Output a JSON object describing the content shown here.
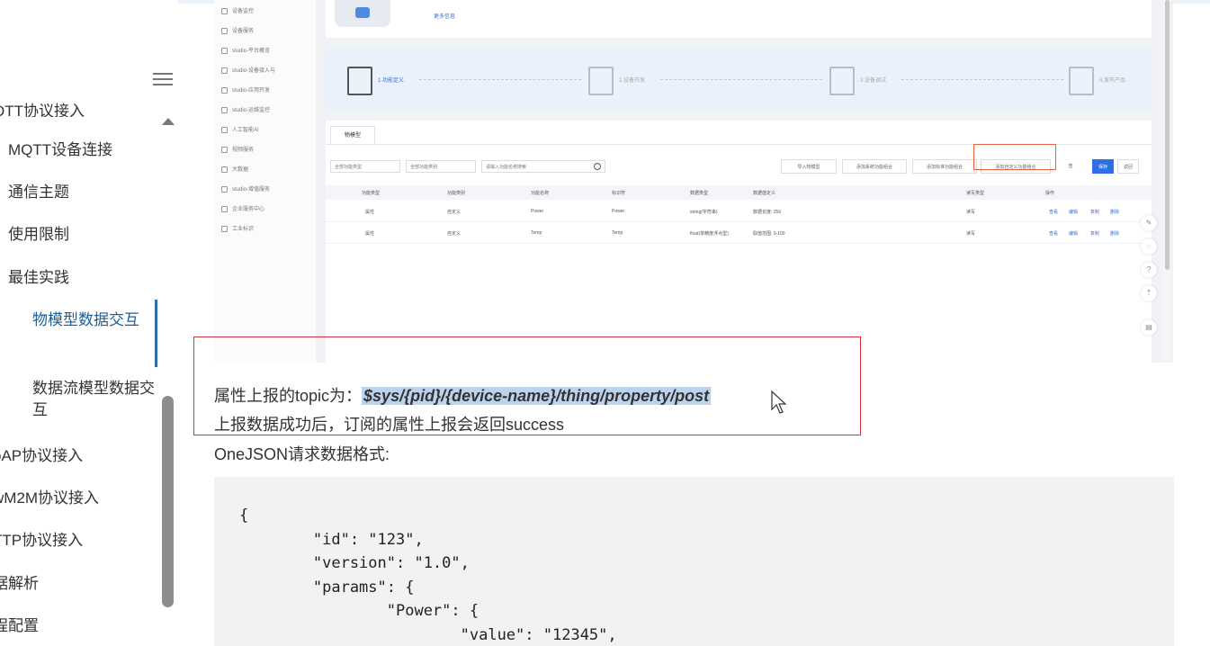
{
  "nav": {
    "items": [
      {
        "label": "QTT协议接入",
        "kind": "cut"
      },
      {
        "label": "MQTT设备连接",
        "kind": "item"
      },
      {
        "label": "通信主题",
        "kind": "item"
      },
      {
        "label": "使用限制",
        "kind": "item"
      },
      {
        "label": "最佳实践",
        "kind": "item"
      },
      {
        "label": "物模型数据交互",
        "kind": "active"
      },
      {
        "label": "数据流模型数据交互",
        "kind": "sub"
      },
      {
        "label": "oAP协议接入",
        "kind": "cut"
      },
      {
        "label": "wM2M协议接入",
        "kind": "cut"
      },
      {
        "label": "TTP协议接入",
        "kind": "cut"
      },
      {
        "label": "据解析",
        "kind": "cut"
      },
      {
        "label": "程配置",
        "kind": "cut"
      }
    ]
  },
  "embed": {
    "sidebar": [
      "设备监控",
      "设备服务",
      "studio-平台概览",
      "studio-设备接入与",
      "studio-应用开发",
      "studio-运维监控",
      "人工智能AI",
      "视频服务",
      "大数据",
      "studio-增值服务",
      "企业服务中心",
      "工业标识"
    ],
    "more_label": "更多信息",
    "steps": [
      "1.功能定义",
      "2.设备开发",
      "3.设备调试",
      "4.发布产品"
    ],
    "tab": "物模型",
    "filters": {
      "type": "全部功能类型",
      "category": "全部功能类别",
      "search_placeholder": "请输入功能名称搜索"
    },
    "buttons": {
      "import": "导入物模型",
      "add_system": "添加系统功能组合",
      "add_standard": "添加标准功能组合",
      "add_custom": "添加自定义功能组合",
      "more": "查",
      "save": "保存",
      "back": "返回"
    },
    "columns": [
      "功能类型",
      "功能类别",
      "功能名称",
      "标识符",
      "数据类型",
      "数据值定义",
      "读写类型",
      "操作"
    ],
    "rows": [
      {
        "type": "属性",
        "category": "自定义",
        "name": "Power",
        "id": "Power",
        "dtype": "string(字符串)",
        "def": "数据长度: 256",
        "rw": "读写"
      },
      {
        "type": "属性",
        "category": "自定义",
        "name": "Temp",
        "id": "Temp",
        "dtype": "float(单精度浮点型)",
        "def": "取值范围: 0-100",
        "rw": "读写"
      }
    ],
    "row_actions": [
      "查看",
      "编辑",
      "复制",
      "删除"
    ]
  },
  "article": {
    "topic_prefix": "属性上报的topic为：",
    "topic_value": "$sys/{pid}/{device-name}/thing/property/post",
    "success_line": "上报数据成功后，订阅的属性上报会返回success",
    "format_label": "OneJSON请求数据格式:",
    "code": "{\n        \"id\": \"123\",\n        \"version\": \"1.0\",\n        \"params\": {\n                \"Power\": {\n                        \"value\": \"12345\","
  }
}
